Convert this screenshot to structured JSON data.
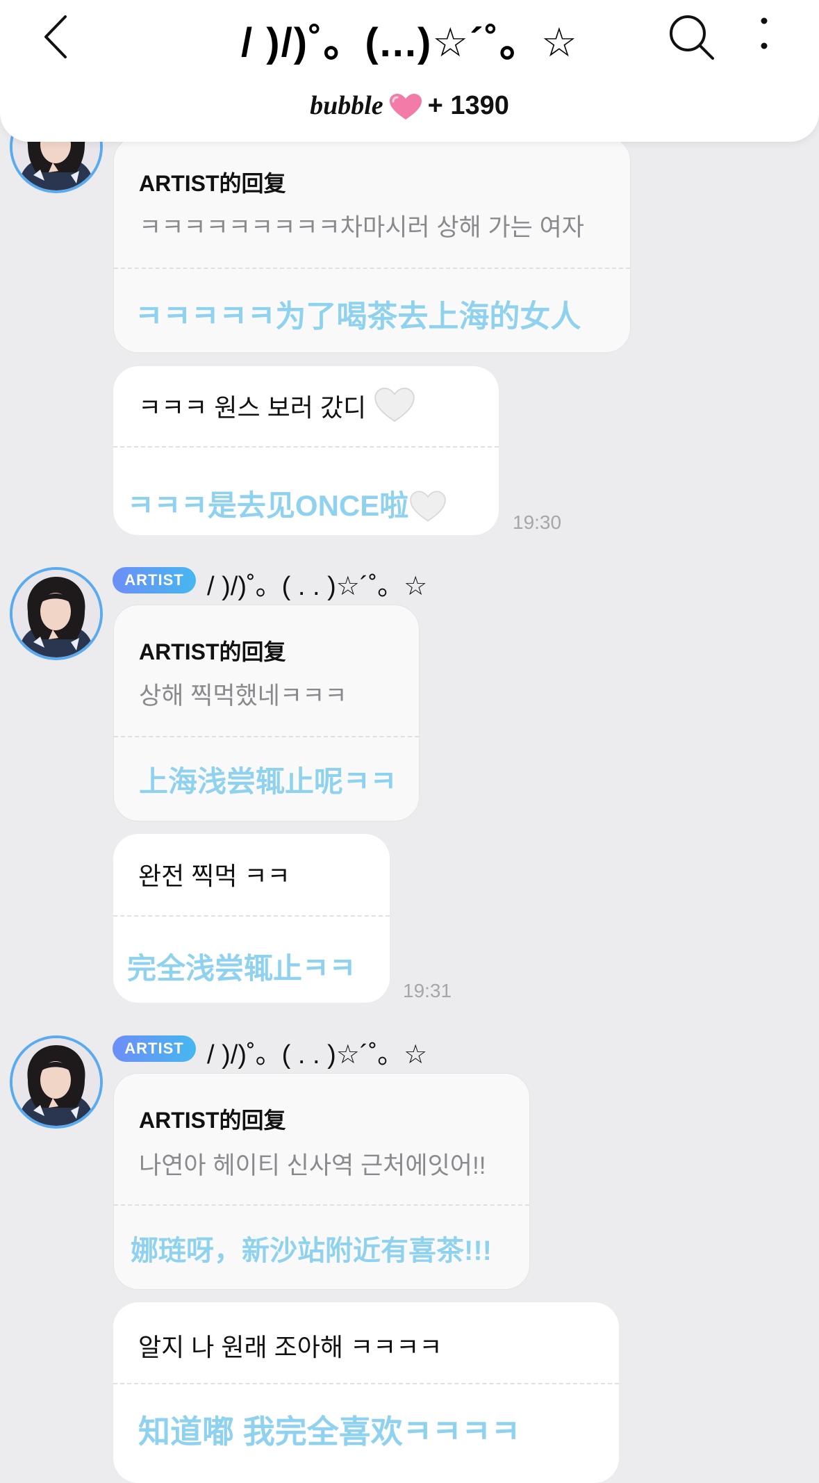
{
  "header": {
    "title": "/ )/)˚。(...)☆´˚。☆",
    "bubble_word": "bubble",
    "plus_count": "+ 1390"
  },
  "colors": {
    "avatar_ring": "#5aaaf0",
    "badge_start": "#6d8ef7",
    "badge_end": "#45b7f0",
    "translation": "#8fd2ef",
    "heart_pink": "#f27ba8"
  },
  "icons": {
    "back": "chevron-left-icon",
    "search": "search-icon",
    "more": "more-vertical-icon",
    "heart": "heart-icon"
  },
  "messages": [
    {
      "reply_label": "ARTIST的回复",
      "reply_quote": "ㅋㅋㅋㅋㅋㅋㅋㅋㅋ차마시러 상해 가는 여자",
      "reply_translation": "ㅋㅋㅋㅋㅋ为了喝茶去上海的女人",
      "text": "ㅋㅋㅋ 원스 보러 갔디",
      "translation": "ㅋㅋㅋ是去见ONCE啦",
      "time": "19:30"
    },
    {
      "badge": "ARTIST",
      "name": "/ )/)˚。( . . )☆´˚。☆",
      "reply_label": "ARTIST的回复",
      "reply_quote": "상해 찍먹했네ㅋㅋㅋ",
      "reply_translation": "上海浅尝辄止呢ㅋㅋ",
      "text": "완전 찍먹 ㅋㅋ",
      "translation": "完全浅尝辄止ㅋㅋ",
      "time": "19:31"
    },
    {
      "badge": "ARTIST",
      "name": "/ )/)˚。( . . )☆´˚。☆",
      "reply_label": "ARTIST的回复",
      "reply_quote": "나연아 헤이티 신사역 근처에잇어!!",
      "reply_translation": "娜琏呀，新沙站附近有喜茶!!!",
      "text": "알지 나 원래 조아해 ㅋㅋㅋㅋ",
      "translation": "知道嘟 我完全喜欢ㅋㅋㅋㅋ"
    }
  ]
}
